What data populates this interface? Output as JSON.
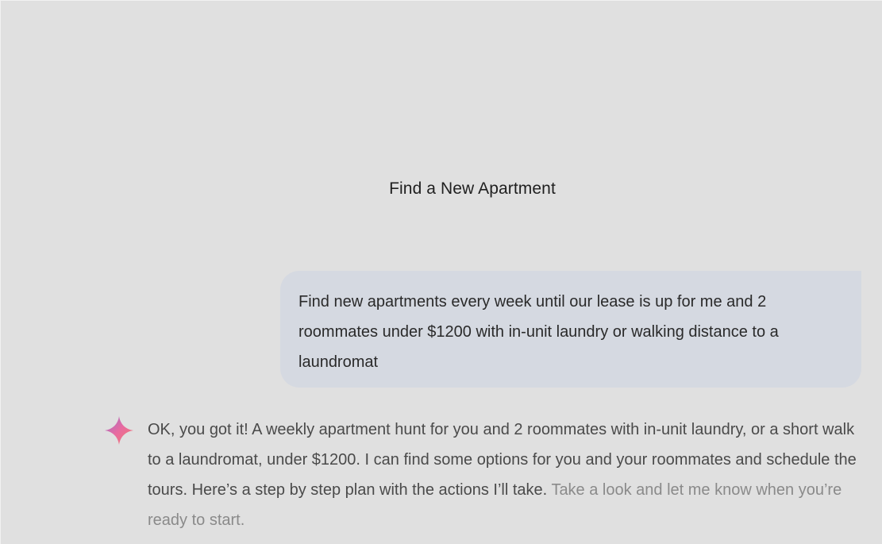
{
  "chat": {
    "title": "Find a New Apartment"
  },
  "user_message": {
    "text": "Find new apartments every week until our lease is up for me and 2 roommates under $1200 with in-unit laundry or walking distance to a laundromat"
  },
  "assistant_message": {
    "icon": "gemini-sparkle-icon",
    "text": "OK, you got it! A weekly apartment hunt for you and 2 roommates with in-unit laundry, or a short walk to a laundromat, under $1200. I can find some options for you and your roommates and schedule the tours. Here’s a step by step plan with the actions I’ll take.",
    "text_fading": "Take a look and let me know when you’re ready to start."
  },
  "colors": {
    "background": "#e0e0e0",
    "user_bubble": "#d5d9e1",
    "sparkle_start": "#4f8df5",
    "sparkle_mid": "#e86aa0",
    "sparkle_end": "#f27a6b"
  }
}
